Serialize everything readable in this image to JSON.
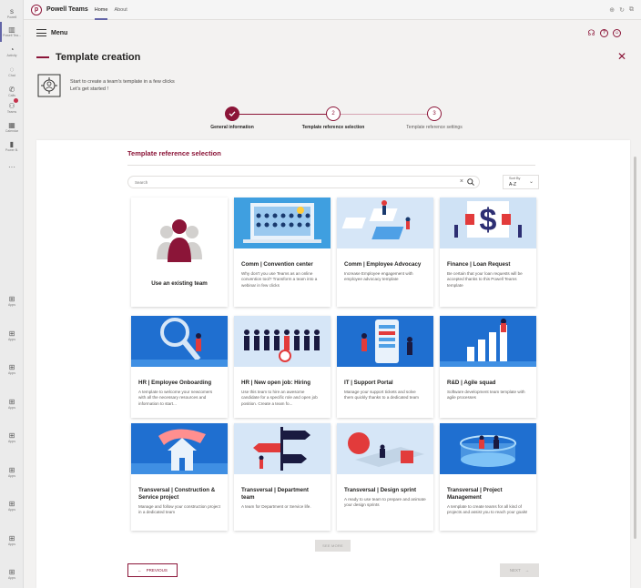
{
  "rail": {
    "items": [
      {
        "label": "Powell",
        "icon": "s"
      },
      {
        "label": "Powell Tea...",
        "icon": "▥"
      },
      {
        "label": "Activity",
        "icon": "◔"
      },
      {
        "label": "Chat",
        "icon": "◌"
      },
      {
        "label": "Calls",
        "icon": "✆"
      },
      {
        "label": "Teams",
        "icon": "⚇"
      },
      {
        "label": "Calendar",
        "icon": "▦"
      },
      {
        "label": "Power B.",
        "icon": "▮"
      },
      {
        "label": "",
        "icon": "···"
      }
    ],
    "apps": [
      "Apps",
      "Apps",
      "Apps",
      "Apps",
      "Apps",
      "Apps",
      "Apps",
      "Apps",
      "Apps"
    ]
  },
  "topbar": {
    "app_name": "Powell Teams",
    "tabs": [
      "Home",
      "About"
    ]
  },
  "menubar": {
    "label": "Menu"
  },
  "page": {
    "title": "Template creation",
    "intro_line1": "Start to create a team's template in a few clicks",
    "intro_line2": "Let's get started !"
  },
  "stepper": {
    "steps": [
      {
        "number": "1",
        "label": "General information",
        "state": "done"
      },
      {
        "number": "2",
        "label": "Template reference selection",
        "state": "current"
      },
      {
        "number": "3",
        "label": "Template reference settings",
        "state": "todo"
      }
    ]
  },
  "selection": {
    "title": "Template reference selection",
    "search_placeholder": "Search",
    "search_clear": "×",
    "sort_label": "Sort By",
    "sort_value": "A-Z",
    "existing_label": "Use an existing team",
    "see_more": "SEE MORE",
    "previous": "PREVIOUS",
    "next": "NEXT"
  },
  "templates": [
    {
      "title": "Comm | Convention center",
      "desc": "Why don't you use Teams as an online convention tool? Transform a team into a webinar in few clicks",
      "art": "convention"
    },
    {
      "title": "Comm | Employee Advocacy",
      "desc": "Increase Employee engagement with employee advocacy template",
      "art": "advocacy"
    },
    {
      "title": "Finance | Loan Request",
      "desc": "Be certain that your loan requests will be accepted thanks to this Powell Teams template",
      "art": "loan"
    },
    {
      "title": "HR | Employee Onboarding",
      "desc": "A template to welcome your newcomers with all the necessary resources and information to start...",
      "art": "onboarding"
    },
    {
      "title": "HR | New open job: Hiring",
      "desc": "Use this team to hire an awesome candidate for a specific role and open job position. Create a team fo...",
      "art": "hiring"
    },
    {
      "title": "IT | Support Portal",
      "desc": "Manage your support tickets and solve them quickly thanks to a dedicated team",
      "art": "support"
    },
    {
      "title": "R&D | Agile squad",
      "desc": "Software development team template with agile processes",
      "art": "agile"
    },
    {
      "title": "Transversal | Construction & Service project",
      "desc": "Manage and follow your construction project in a dedicated team",
      "art": "construction"
    },
    {
      "title": "Transversal | Department team",
      "desc": "A team for Department or Service life.",
      "art": "department"
    },
    {
      "title": "Transversal | Design sprint",
      "desc": "A ready to use team to prepare and animate your design sprints",
      "art": "sprint"
    },
    {
      "title": "Transversal | Project Management",
      "desc": "A template to create teams for all kind of projects and assist you to reach your goals!",
      "art": "project"
    }
  ]
}
